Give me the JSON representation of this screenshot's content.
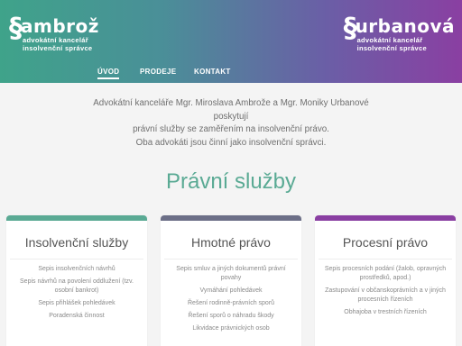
{
  "header": {
    "left_logo": {
      "mark": "§",
      "name": "ambrož",
      "sub_line1": "advokátní kancelář",
      "sub_line2": "insolvenční správce"
    },
    "right_logo": {
      "mark": "§",
      "name": "urbanová",
      "sub_line1": "advokátní kancelář",
      "sub_line2": "insolvenční správce"
    }
  },
  "nav": {
    "items": [
      {
        "label": "ÚVOD",
        "active": true
      },
      {
        "label": "PRODEJE",
        "active": false
      },
      {
        "label": "KONTAKT",
        "active": false
      }
    ]
  },
  "intro": {
    "line1": "Advokátní kanceláře Mgr. Miroslava Ambrože a Mgr. Moniky Urbanové",
    "line2": "poskytují",
    "line3": "právní služby se zaměřením na insolvenční právo.",
    "line4": "Oba advokáti jsou činní jako insolvenční správci."
  },
  "section_title": "Právní služby",
  "colors": {
    "green": "#5aaa94",
    "purple_gray": "#6c6f87",
    "purple": "#8a3fa2"
  },
  "cards": [
    {
      "title": "Insolvenční služby",
      "items": [
        "Sepis insolvenčních návrhů",
        "Sepis návrhů na povolení oddlužení (tzv. osobní bankrot)",
        "Sepis přihlášek pohledávek",
        "Poradenská činnost"
      ]
    },
    {
      "title": "Hmotné právo",
      "items": [
        "Sepis smluv a jiných dokumentů právní povahy",
        "Vymáhání pohledávek",
        "Řešení rodinně-právních sporů",
        "Řešení sporů o náhradu škody",
        "Likvidace právnických osob"
      ]
    },
    {
      "title": "Procesní právo",
      "items": [
        "Sepis procesních podání (žalob, opravných prostředků, apod.)",
        "Zastupování v občanskoprávních a v jiných procesních řízeních",
        "Obhajoba v trestních řízeních"
      ]
    }
  ]
}
